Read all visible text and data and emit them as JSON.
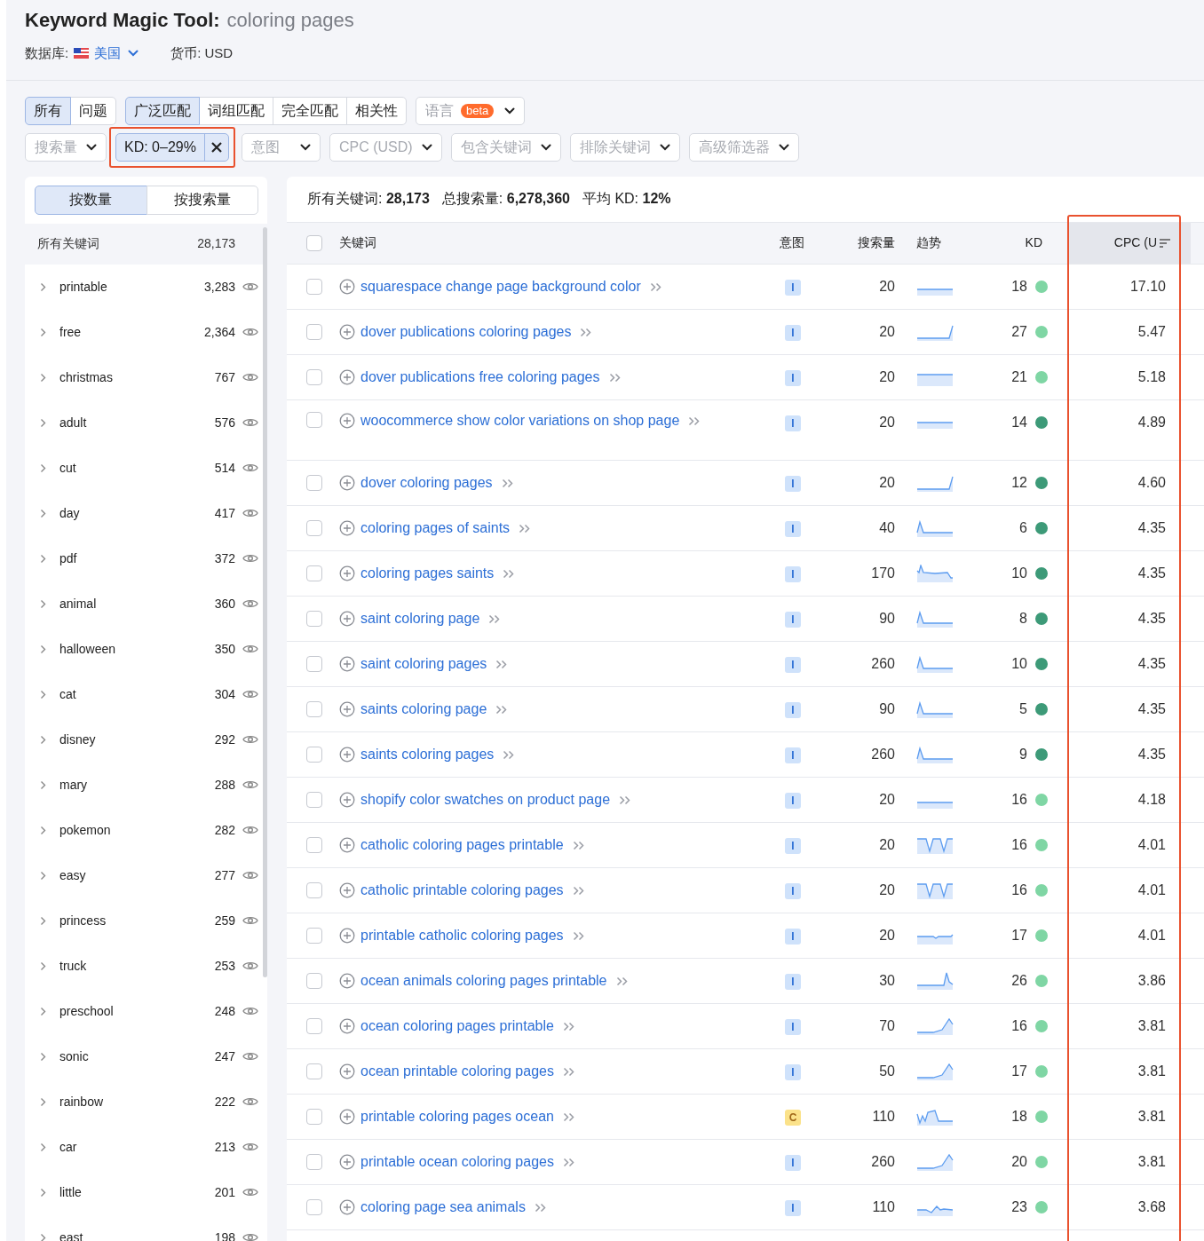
{
  "header": {
    "title": "Keyword Magic Tool:",
    "query": "coloring pages",
    "database_label": "数据库:",
    "database_value": "美国",
    "currency": "货币: USD"
  },
  "tabs_type": [
    {
      "label": "所有",
      "selected": true
    },
    {
      "label": "问题",
      "selected": false
    }
  ],
  "tabs_match": [
    {
      "label": "广泛匹配",
      "selected": true
    },
    {
      "label": "词组匹配",
      "selected": false
    },
    {
      "label": "完全匹配",
      "selected": false
    },
    {
      "label": "相关性",
      "selected": false
    }
  ],
  "language": {
    "label": "语言",
    "badge": "beta"
  },
  "filters": [
    {
      "kind": "dropdown",
      "label": "搜索量"
    },
    {
      "kind": "chip",
      "label": "KD: 0–29%"
    },
    {
      "kind": "dropdown",
      "label": "意图"
    },
    {
      "kind": "dropdown",
      "label": "CPC (USD)"
    },
    {
      "kind": "dropdown",
      "label": "包含关键词"
    },
    {
      "kind": "dropdown",
      "label": "排除关键词"
    },
    {
      "kind": "dropdown",
      "label": "高级筛选器"
    }
  ],
  "sidebar": {
    "toggle": [
      {
        "label": "按数量",
        "selected": true
      },
      {
        "label": "按搜索量",
        "selected": false
      }
    ],
    "all": {
      "label": "所有关键词",
      "count": "28,173"
    },
    "items": [
      {
        "label": "printable",
        "count": "3,283"
      },
      {
        "label": "free",
        "count": "2,364"
      },
      {
        "label": "christmas",
        "count": "767"
      },
      {
        "label": "adult",
        "count": "576"
      },
      {
        "label": "cut",
        "count": "514"
      },
      {
        "label": "day",
        "count": "417"
      },
      {
        "label": "pdf",
        "count": "372"
      },
      {
        "label": "animal",
        "count": "360"
      },
      {
        "label": "halloween",
        "count": "350"
      },
      {
        "label": "cat",
        "count": "304"
      },
      {
        "label": "disney",
        "count": "292"
      },
      {
        "label": "mary",
        "count": "288"
      },
      {
        "label": "pokemon",
        "count": "282"
      },
      {
        "label": "easy",
        "count": "277"
      },
      {
        "label": "princess",
        "count": "259"
      },
      {
        "label": "truck",
        "count": "253"
      },
      {
        "label": "preschool",
        "count": "248"
      },
      {
        "label": "sonic",
        "count": "247"
      },
      {
        "label": "rainbow",
        "count": "222"
      },
      {
        "label": "car",
        "count": "213"
      },
      {
        "label": "little",
        "count": "201"
      },
      {
        "label": "east",
        "count": "198"
      }
    ]
  },
  "summary": [
    {
      "label": "所有关键词:",
      "value": "28,173"
    },
    {
      "label": "总搜索量:",
      "value": "6,278,360"
    },
    {
      "label": "平均 KD:",
      "value": "12%"
    }
  ],
  "table": {
    "select_all": {
      "checked": false
    },
    "columns": [
      {
        "label": "关键词",
        "sorted": false
      },
      {
        "label": "意图",
        "sorted": false
      },
      {
        "label": "搜索量",
        "sorted": false
      },
      {
        "label": "趋势",
        "sorted": false
      },
      {
        "label": "KD",
        "sorted": false
      },
      {
        "label": "CPC (U",
        "sorted": true
      }
    ],
    "rows": [
      {
        "checked": false,
        "keyword": "squarespace change page background color",
        "intent": "I",
        "volume": "20",
        "trend": {
          "kind": "flat"
        },
        "kd": "18",
        "color": "#7fd6a4",
        "cpc": "17.10"
      },
      {
        "checked": false,
        "keyword": "dover publications coloring pages",
        "intent": "I",
        "volume": "20",
        "trend": {
          "kind": "step-up"
        },
        "kd": "27",
        "color": "#7fd6a4",
        "cpc": "5.47"
      },
      {
        "checked": false,
        "keyword": "dover publications free coloring pages",
        "intent": "I",
        "volume": "20",
        "trend": {
          "kind": "block"
        },
        "kd": "21",
        "color": "#7fd6a4",
        "cpc": "5.18"
      },
      {
        "checked": false,
        "keyword": "woocommerce show color variations on shop page",
        "intent": "I",
        "volume": "20",
        "trend": {
          "kind": "flat"
        },
        "kd": "14",
        "color": "#3d9a78",
        "cpc": "4.89"
      },
      {
        "checked": false,
        "keyword": "dover coloring pages",
        "intent": "I",
        "volume": "20",
        "trend": {
          "kind": "step-up"
        },
        "kd": "12",
        "color": "#3d9a78",
        "cpc": "4.60"
      },
      {
        "checked": false,
        "keyword": "coloring pages of saints",
        "intent": "I",
        "volume": "40",
        "trend": {
          "kind": "early-peak"
        },
        "kd": "6",
        "color": "#3d9a78",
        "cpc": "4.35"
      },
      {
        "checked": false,
        "keyword": "coloring pages saints",
        "intent": "I",
        "volume": "170",
        "trend": {
          "kind": "jagged-peak"
        },
        "kd": "10",
        "color": "#3d9a78",
        "cpc": "4.35"
      },
      {
        "checked": false,
        "keyword": "saint coloring page",
        "intent": "I",
        "volume": "90",
        "trend": {
          "kind": "early-peak"
        },
        "kd": "8",
        "color": "#3d9a78",
        "cpc": "4.35"
      },
      {
        "checked": false,
        "keyword": "saint coloring pages",
        "intent": "I",
        "volume": "260",
        "trend": {
          "kind": "early-peak"
        },
        "kd": "10",
        "color": "#3d9a78",
        "cpc": "4.35"
      },
      {
        "checked": false,
        "keyword": "saints coloring page",
        "intent": "I",
        "volume": "90",
        "trend": {
          "kind": "early-peak"
        },
        "kd": "5",
        "color": "#3d9a78",
        "cpc": "4.35"
      },
      {
        "checked": false,
        "keyword": "saints coloring pages",
        "intent": "I",
        "volume": "260",
        "trend": {
          "kind": "early-peak"
        },
        "kd": "9",
        "color": "#3d9a78",
        "cpc": "4.35"
      },
      {
        "checked": false,
        "keyword": "shopify color swatches on product page",
        "intent": "I",
        "volume": "20",
        "trend": {
          "kind": "flat"
        },
        "kd": "16",
        "color": "#7fd6a4",
        "cpc": "4.18"
      },
      {
        "checked": false,
        "keyword": "catholic coloring pages printable",
        "intent": "I",
        "volume": "20",
        "trend": {
          "kind": "notch"
        },
        "kd": "16",
        "color": "#7fd6a4",
        "cpc": "4.01"
      },
      {
        "checked": false,
        "keyword": "catholic printable coloring pages",
        "intent": "I",
        "volume": "20",
        "trend": {
          "kind": "notch"
        },
        "kd": "16",
        "color": "#7fd6a4",
        "cpc": "4.01"
      },
      {
        "checked": false,
        "keyword": "printable catholic coloring pages",
        "intent": "I",
        "volume": "20",
        "trend": {
          "kind": "dip"
        },
        "kd": "17",
        "color": "#7fd6a4",
        "cpc": "4.01"
      },
      {
        "checked": false,
        "keyword": "ocean animals coloring pages printable",
        "intent": "I",
        "volume": "30",
        "trend": {
          "kind": "late-spike"
        },
        "kd": "26",
        "color": "#7fd6a4",
        "cpc": "3.86"
      },
      {
        "checked": false,
        "keyword": "ocean coloring pages printable",
        "intent": "I",
        "volume": "70",
        "trend": {
          "kind": "late-rise"
        },
        "kd": "16",
        "color": "#7fd6a4",
        "cpc": "3.81"
      },
      {
        "checked": false,
        "keyword": "ocean printable coloring pages",
        "intent": "I",
        "volume": "50",
        "trend": {
          "kind": "late-rise"
        },
        "kd": "17",
        "color": "#7fd6a4",
        "cpc": "3.81"
      },
      {
        "checked": false,
        "keyword": "printable coloring pages ocean",
        "intent": "C",
        "volume": "110",
        "trend": {
          "kind": "wave"
        },
        "kd": "18",
        "color": "#7fd6a4",
        "cpc": "3.81"
      },
      {
        "checked": false,
        "keyword": "printable ocean coloring pages",
        "intent": "I",
        "volume": "260",
        "trend": {
          "kind": "late-rise"
        },
        "kd": "20",
        "color": "#7fd6a4",
        "cpc": "3.81"
      },
      {
        "checked": false,
        "keyword": "coloring page sea animals",
        "intent": "I",
        "volume": "110",
        "trend": {
          "kind": "wobble"
        },
        "kd": "23",
        "color": "#7fd6a4",
        "cpc": "3.68"
      }
    ]
  }
}
